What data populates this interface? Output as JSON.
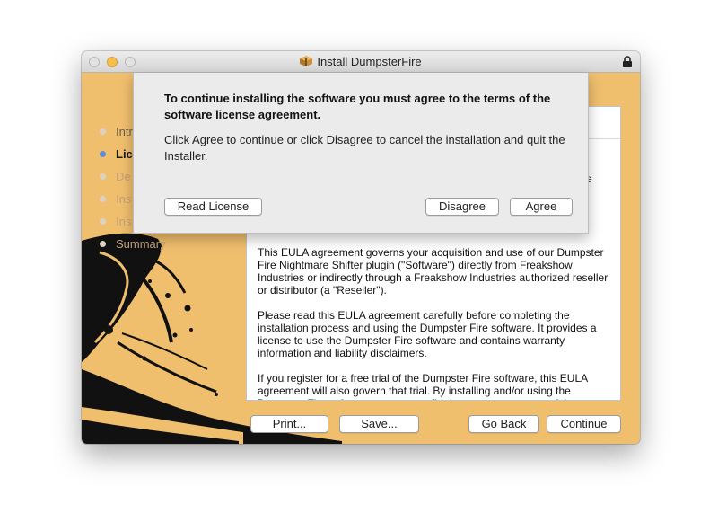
{
  "window": {
    "title": "Install DumpsterFire",
    "accent_color": "#f0bf6e"
  },
  "sidebar": {
    "steps": [
      {
        "label": "Intr",
        "state": "done"
      },
      {
        "label": "Lic",
        "state": "active"
      },
      {
        "label": "De",
        "state": "pending"
      },
      {
        "label": "Ins",
        "state": "pending"
      },
      {
        "label": "Ins",
        "state": "pending"
      },
      {
        "label": "Summary",
        "state": "pending"
      }
    ]
  },
  "license": {
    "fragment": "e",
    "paragraphs": [
      "This EULA agreement governs your acquisition and use of our Dumpster Fire Nightmare Shifter plugin (\"Software\") directly from Freakshow Industries or indirectly through a Freakshow Industries authorized reseller or distributor (a \"Reseller\").",
      "Please read this EULA agreement carefully before completing the installation process and using the Dumpster Fire software. It provides a license to use the Dumpster Fire software and contains warranty information and liability disclaimers.",
      "If you register for a free trial of the Dumpster Fire software, this EULA agreement will also govern that trial. By installing and/or using the Dumpster Fire software, you are confirming your acceptance of the Software and agreeing to become bound by the terms of this EULA agreement."
    ]
  },
  "buttons": {
    "print": "Print...",
    "save": "Save...",
    "go_back": "Go Back",
    "continue": "Continue"
  },
  "sheet": {
    "heading": "To continue installing the software you must agree to the terms of the software license agreement.",
    "message": "Click Agree to continue or click Disagree to cancel the installation and quit the Installer.",
    "read_license": "Read License",
    "disagree": "Disagree",
    "agree": "Agree"
  }
}
